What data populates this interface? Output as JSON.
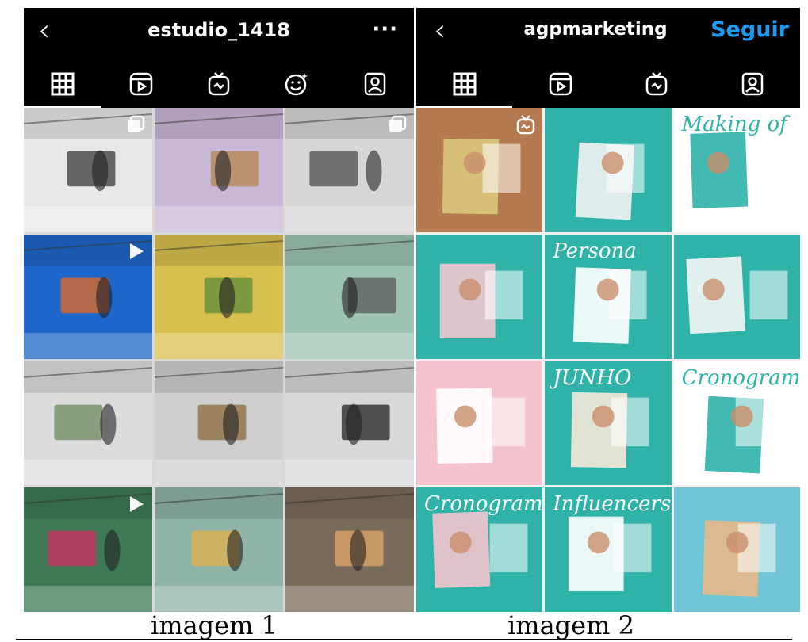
{
  "panel1": {
    "username": "estudio_1418",
    "back_icon": "‹",
    "more_icon": "···",
    "caption": "imagem 1",
    "tabs": [
      "grid-icon",
      "reels-icon",
      "igtv-icon",
      "effects-icon",
      "tagged-icon"
    ],
    "tiles": [
      {
        "name": "studio-bw-shoot",
        "bg": "#e8e8e8",
        "accent": "#3a3a3a",
        "badge": "multi-icon"
      },
      {
        "name": "laptop-lilac-room",
        "bg": "#c9b7d6",
        "accent": "#b3854e",
        "badge": ""
      },
      {
        "name": "studio-white-set",
        "bg": "#d6d6d6",
        "accent": "#4d4d4d",
        "badge": "multi-icon"
      },
      {
        "name": "phone-preview",
        "bg": "#1e66c9",
        "accent": "#e46a1d",
        "badge": "play-icon"
      },
      {
        "name": "laptop-color-backdrop",
        "bg": "#d8c04f",
        "accent": "#5e8c3a",
        "badge": ""
      },
      {
        "name": "crew-pastel-set",
        "bg": "#9ec3b0",
        "accent": "#5a5a5a",
        "badge": ""
      },
      {
        "name": "team-meeting-studio",
        "bg": "#dcdcdc",
        "accent": "#6e8a5e",
        "badge": ""
      },
      {
        "name": "ladder-white-set",
        "bg": "#cfcfcf",
        "accent": "#8a6a3a",
        "badge": ""
      },
      {
        "name": "photographer-umbrella",
        "bg": "#d8d8d8",
        "accent": "#222222",
        "badge": ""
      },
      {
        "name": "model-green-wall",
        "bg": "#3d7a55",
        "accent": "#d32f64",
        "badge": "play-icon"
      },
      {
        "name": "colorful-set-crowd",
        "bg": "#8fb3a6",
        "accent": "#e0b24b",
        "badge": ""
      },
      {
        "name": "backstage-lighting",
        "bg": "#7a6a5a",
        "accent": "#e3a96b",
        "badge": ""
      }
    ]
  },
  "panel2": {
    "username": "agpmarketing",
    "back_icon": "‹",
    "follow_label": "Seguir",
    "caption": "imagem 2",
    "tabs": [
      "grid-icon",
      "reels-icon",
      "igtv-icon",
      "tagged-icon"
    ],
    "tiles": [
      {
        "name": "model-portrait",
        "bg": "#b57a4f",
        "accent": "#d9c67a",
        "badge": "igtv-icon",
        "text": ""
      },
      {
        "name": "meeting-teal",
        "bg": "#2fb3a8",
        "accent": "#f2f2f2",
        "badge": "",
        "text": ""
      },
      {
        "name": "making-of",
        "bg": "#ffffff",
        "accent": "#2fb3a8",
        "badge": "",
        "text": "Making of"
      },
      {
        "name": "tablet-preview",
        "bg": "#2fb3a8",
        "accent": "#f1c6cf",
        "badge": "",
        "text": ""
      },
      {
        "name": "persona-board",
        "bg": "#2fb3a8",
        "accent": "#ffffff",
        "badge": "",
        "text": "Persona"
      },
      {
        "name": "persona-collage",
        "bg": "#2fb3a8",
        "accent": "#f5f5f5",
        "badge": "",
        "text": ""
      },
      {
        "name": "pink-layout",
        "bg": "#f4c3cd",
        "accent": "#ffffff",
        "badge": "",
        "text": ""
      },
      {
        "name": "june-layout",
        "bg": "#2fb3a8",
        "accent": "#f5e9d8",
        "badge": "",
        "text": "JUNHO"
      },
      {
        "name": "cronogramas-vertical",
        "bg": "#ffffff",
        "accent": "#2fb3a8",
        "badge": "",
        "text": "Cronogramas"
      },
      {
        "name": "cronogramas-card",
        "bg": "#2fb3a8",
        "accent": "#f4c3cd",
        "badge": "",
        "text": "Cronogramas"
      },
      {
        "name": "influencers-phone",
        "bg": "#2fb3a8",
        "accent": "#ffffff",
        "badge": "",
        "text": "Influencers"
      },
      {
        "name": "post-mockup",
        "bg": "#6fc4d6",
        "accent": "#e8b98a",
        "badge": "",
        "text": ""
      }
    ]
  },
  "colors": {
    "topbar": "#000000",
    "follow": "#1d9bf0",
    "teal": "#2fb3a8",
    "pink": "#f4c3cd"
  }
}
